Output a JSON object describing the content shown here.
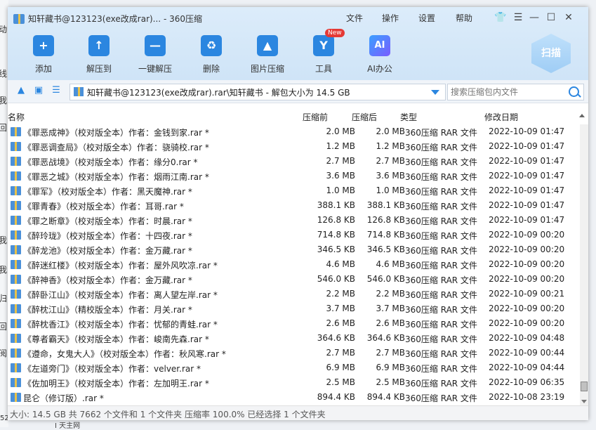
{
  "background": {
    "left_chars": [
      "动",
      "线",
      "我",
      "回",
      "我",
      "我",
      "归",
      "回",
      "阅"
    ],
    "bottom_left": "52",
    "bottom_text": "I 天主网"
  },
  "window": {
    "title": "知轩藏书@123123(exe改成rar)... - 360压缩",
    "menu": [
      "文件",
      "操作",
      "设置",
      "帮助"
    ],
    "controls": [
      "shirt-icon",
      "menu-icon",
      "minimize-icon",
      "maximize-icon",
      "close-icon"
    ]
  },
  "toolbar": [
    {
      "label": "添加",
      "icon": "add-icon",
      "glyph": "+"
    },
    {
      "label": "解压到",
      "icon": "extract-to-icon",
      "glyph": "↑"
    },
    {
      "label": "一键解压",
      "icon": "one-click-extract-icon",
      "glyph": "—"
    },
    {
      "label": "删除",
      "icon": "delete-icon",
      "glyph": "♻"
    },
    {
      "label": "图片压缩",
      "icon": "image-compress-icon",
      "glyph": "▲"
    },
    {
      "label": "工具",
      "icon": "tools-icon",
      "glyph": "Y",
      "badge": "New"
    },
    {
      "label": "AI办公",
      "icon": "ai-office-icon",
      "glyph": "AI"
    }
  ],
  "scan_label": "扫描",
  "address": {
    "path": "知轩藏书@123123(exe改成rar).rar\\知轩藏书 - 解包大小为 14.5 GB",
    "search_placeholder": "搜索压缩包内文件"
  },
  "columns": {
    "name": "名称",
    "size": "压缩前",
    "compressed": "压缩后",
    "type": "类型",
    "date": "修改日期"
  },
  "files": [
    {
      "name": "《罪恶成神》（校对版全本）作者：金钱到家.rar *",
      "size": "2.0 MB",
      "compressed": "2.0 MB",
      "type": "360压缩 RAR 文件",
      "date": "2022-10-09 01:47"
    },
    {
      "name": "《罪恶调查局》（校对版全本）作者：骁骑校.rar *",
      "size": "1.2 MB",
      "compressed": "1.2 MB",
      "type": "360压缩 RAR 文件",
      "date": "2022-10-09 01:47"
    },
    {
      "name": "《罪恶战境》（校对版全本）作者：缘分0.rar *",
      "size": "2.7 MB",
      "compressed": "2.7 MB",
      "type": "360压缩 RAR 文件",
      "date": "2022-10-09 01:47"
    },
    {
      "name": "《罪恶之城》（校对版全本）作者：烟雨江南.rar *",
      "size": "3.6 MB",
      "compressed": "3.6 MB",
      "type": "360压缩 RAR 文件",
      "date": "2022-10-09 01:47"
    },
    {
      "name": "《罪军》（校对版全本）作者：黑天魔神.rar *",
      "size": "1.0 MB",
      "compressed": "1.0 MB",
      "type": "360压缩 RAR 文件",
      "date": "2022-10-09 01:47"
    },
    {
      "name": "《罪青春》（校对版全本）作者：耳哥.rar *",
      "size": "388.1 KB",
      "compressed": "388.1 KB",
      "type": "360压缩 RAR 文件",
      "date": "2022-10-09 01:47"
    },
    {
      "name": "《罪之断章》（校对版全本）作者：时晨.rar *",
      "size": "126.8 KB",
      "compressed": "126.8 KB",
      "type": "360压缩 RAR 文件",
      "date": "2022-10-09 01:47"
    },
    {
      "name": "《醉玲珑》（校对版全本）作者：十四夜.rar *",
      "size": "714.8 KB",
      "compressed": "714.8 KB",
      "type": "360压缩 RAR 文件",
      "date": "2022-10-09 00:20"
    },
    {
      "name": "《醉龙池》（校对版全本）作者：金万藏.rar *",
      "size": "346.5 KB",
      "compressed": "346.5 KB",
      "type": "360压缩 RAR 文件",
      "date": "2022-10-09 00:20"
    },
    {
      "name": "《醉迷红楼》（校对版全本）作者：屋外风吹凉.rar *",
      "size": "4.6 MB",
      "compressed": "4.6 MB",
      "type": "360压缩 RAR 文件",
      "date": "2022-10-09 00:20"
    },
    {
      "name": "《醉神香》（校对版全本）作者：金万藏.rar *",
      "size": "546.0 KB",
      "compressed": "546.0 KB",
      "type": "360压缩 RAR 文件",
      "date": "2022-10-09 00:20"
    },
    {
      "name": "《醉卧江山》（校对版全本）作者：离人望左岸.rar *",
      "size": "2.2 MB",
      "compressed": "2.2 MB",
      "type": "360压缩 RAR 文件",
      "date": "2022-10-09 00:21"
    },
    {
      "name": "《醉枕江山》（精校版全本）作者：月关.rar *",
      "size": "3.7 MB",
      "compressed": "3.7 MB",
      "type": "360压缩 RAR 文件",
      "date": "2022-10-09 00:20"
    },
    {
      "name": "《醉枕香江》（校对版全本）作者：忧郁的青蛙.rar *",
      "size": "2.6 MB",
      "compressed": "2.6 MB",
      "type": "360压缩 RAR 文件",
      "date": "2022-10-09 00:20"
    },
    {
      "name": "《尊者霸天》（校对版全本）作者：峻南先森.rar *",
      "size": "364.6 KB",
      "compressed": "364.6 KB",
      "type": "360压缩 RAR 文件",
      "date": "2022-10-09 04:48"
    },
    {
      "name": "《遵命，女鬼大人》（校对版全本）作者：秋风寒.rar *",
      "size": "2.7 MB",
      "compressed": "2.7 MB",
      "type": "360压缩 RAR 文件",
      "date": "2022-10-09 00:44"
    },
    {
      "name": "《左道旁门》（校对版全本）作者：velver.rar *",
      "size": "6.9 MB",
      "compressed": "6.9 MB",
      "type": "360压缩 RAR 文件",
      "date": "2022-10-09 04:44"
    },
    {
      "name": "《佐加明王》（校对版全本）作者：左加明王.rar *",
      "size": "2.5 MB",
      "compressed": "2.5 MB",
      "type": "360压缩 RAR 文件",
      "date": "2022-10-09 06:35"
    },
    {
      "name": "昆仑（修订版）.rar *",
      "size": "894.4 KB",
      "compressed": "894.4 KB",
      "type": "360压缩 RAR 文件",
      "date": "2022-10-08 23:19"
    }
  ],
  "status": "大小: 14.5 GB 共 7662 个文件和 1 个文件夹 压缩率 100.0% 已经选择 1 个文件夹",
  "colors": {
    "accent": "#2b86e0",
    "header_bg": "#d6e8f8"
  }
}
